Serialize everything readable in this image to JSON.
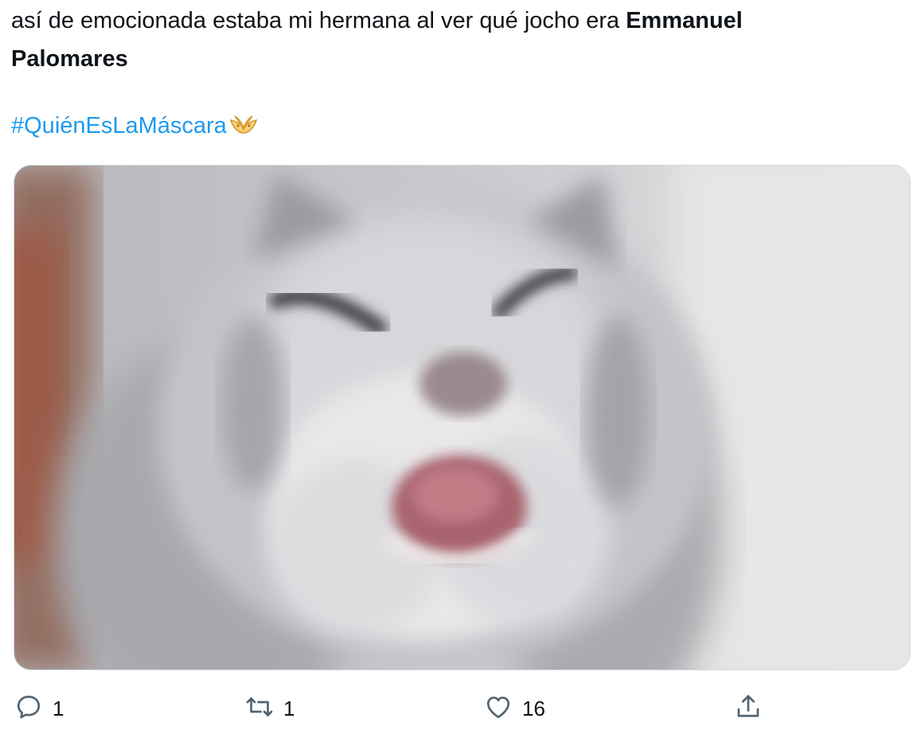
{
  "tweet": {
    "text_line1_regular": "así de emocionada estaba mi hermana al ver qué jocho era ",
    "text_line1_bold": "Emmanuel",
    "text_line2_bold": "Palomares",
    "hashtag": "#QuiénEsLaMáscara",
    "hashflag_icon": "mask-hashflag-icon"
  },
  "media": {
    "description_icon": "cat-meme-image",
    "alt": ""
  },
  "actions": {
    "reply": {
      "icon": "reply-icon",
      "count": "1"
    },
    "retweet": {
      "icon": "retweet-icon",
      "count": "1"
    },
    "like": {
      "icon": "like-heart-icon",
      "count": "16"
    },
    "share": {
      "icon": "share-icon",
      "count": ""
    }
  },
  "colors": {
    "text": "#0f1419",
    "link": "#1d9bf0",
    "icon": "#536471",
    "border": "#cfd9de",
    "hashflag_gold": "#e8b84a"
  }
}
